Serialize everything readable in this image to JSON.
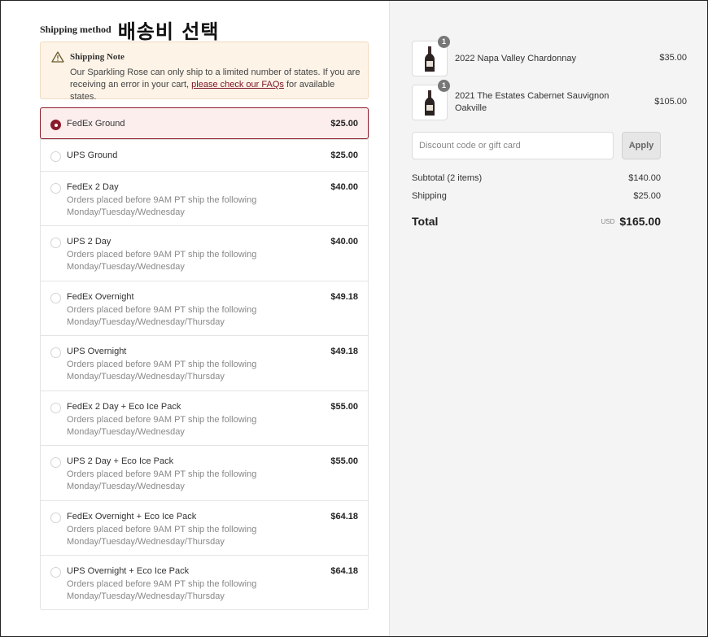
{
  "heading": {
    "title": "Shipping method",
    "korean": "배송비 선택"
  },
  "note": {
    "icon": "warning-triangle-icon",
    "title": "Shipping Note",
    "body_before": "Our Sparkling Rose can only ship to a limited number of states. If you are receiving an error in your cart, ",
    "link_text": "please check our FAQs",
    "body_after": " for available states."
  },
  "methods": [
    {
      "name": "FedEx Ground",
      "price": "$25.00",
      "desc1": "",
      "desc2": "",
      "selected": true
    },
    {
      "name": "UPS Ground",
      "price": "$25.00",
      "desc1": "",
      "desc2": "",
      "selected": false
    },
    {
      "name": "FedEx 2 Day",
      "price": "$40.00",
      "desc1": "Orders placed before 9AM PT ship the following",
      "desc2": "Monday/Tuesday/Wednesday",
      "selected": false
    },
    {
      "name": "UPS 2 Day",
      "price": "$40.00",
      "desc1": "Orders placed before 9AM PT ship the following",
      "desc2": "Monday/Tuesday/Wednesday",
      "selected": false
    },
    {
      "name": "FedEx Overnight",
      "price": "$49.18",
      "desc1": "Orders placed before 9AM PT ship the following",
      "desc2": "Monday/Tuesday/Wednesday/Thursday",
      "selected": false
    },
    {
      "name": "UPS Overnight",
      "price": "$49.18",
      "desc1": "Orders placed before 9AM PT ship the following",
      "desc2": "Monday/Tuesday/Wednesday/Thursday",
      "selected": false
    },
    {
      "name": "FedEx 2 Day + Eco Ice Pack",
      "price": "$55.00",
      "desc1": "Orders placed before 9AM PT ship the following",
      "desc2": "Monday/Tuesday/Wednesday",
      "selected": false
    },
    {
      "name": "UPS 2 Day + Eco Ice Pack",
      "price": "$55.00",
      "desc1": "Orders placed before 9AM PT ship the following",
      "desc2": "Monday/Tuesday/Wednesday",
      "selected": false
    },
    {
      "name": "FedEx Overnight + Eco Ice Pack",
      "price": "$64.18",
      "desc1": "Orders placed before 9AM PT ship the following",
      "desc2": "Monday/Tuesday/Wednesday/Thursday",
      "selected": false
    },
    {
      "name": "UPS Overnight + Eco Ice Pack",
      "price": "$64.18",
      "desc1": "Orders placed before 9AM PT ship the following",
      "desc2": "Monday/Tuesday/Wednesday/Thursday",
      "selected": false
    }
  ],
  "cart": {
    "items": [
      {
        "name": "2022 Napa Valley Chardonnay",
        "name2": "",
        "qty": "1",
        "price": "$35.00",
        "icon": "wine-bottle-icon"
      },
      {
        "name": "2021 The Estates Cabernet Sauvignon",
        "name2": "Oakville",
        "qty": "1",
        "price": "$105.00",
        "icon": "wine-bottle-icon"
      }
    ],
    "discount_placeholder": "Discount code or gift card",
    "apply_label": "Apply",
    "subtotal_label": "Subtotal (2 items)",
    "subtotal_value": "$140.00",
    "shipping_label": "Shipping",
    "shipping_value": "$25.00",
    "total_label": "Total",
    "currency": "USD",
    "total_value": "$165.00"
  },
  "colors": {
    "accent": "#8a1a2a",
    "note_bg": "#fdf3e7",
    "selected_bg": "#fdeeee",
    "sidebar_bg": "#f4f4f4"
  }
}
